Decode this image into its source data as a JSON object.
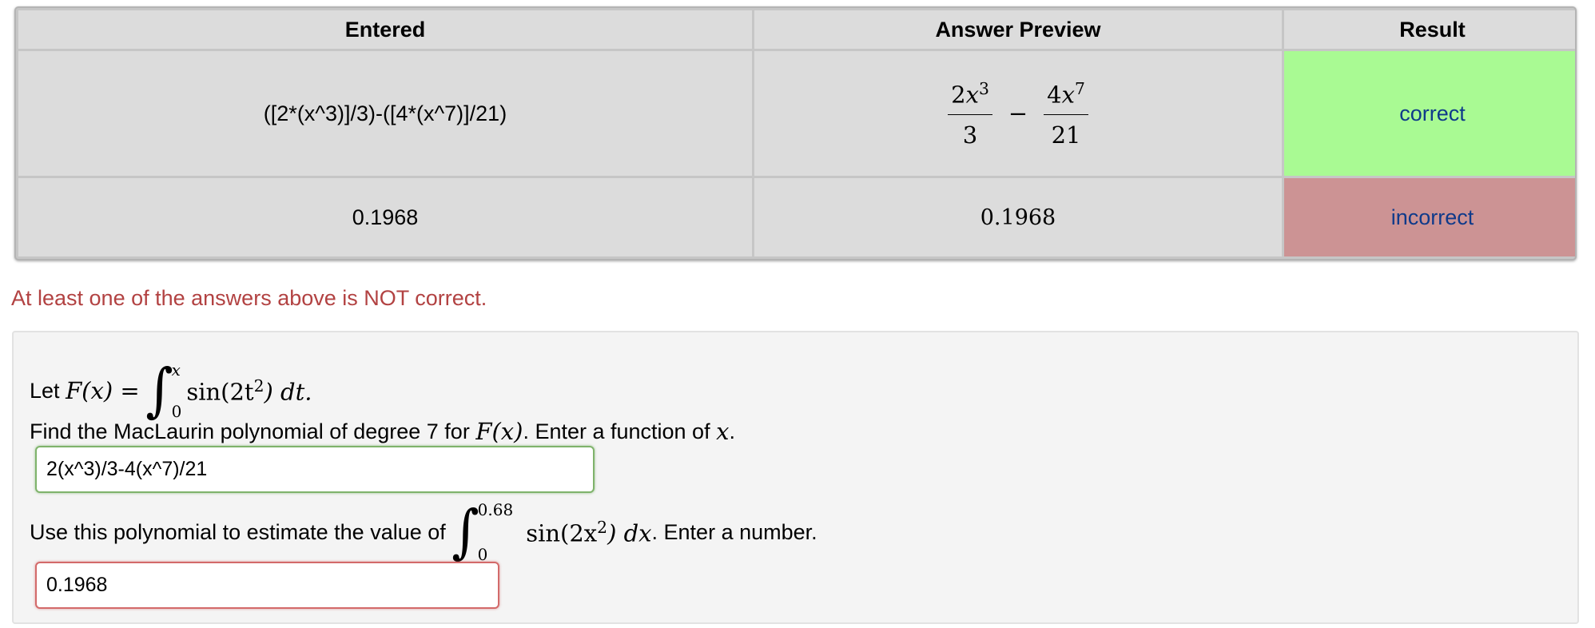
{
  "results_table": {
    "headers": [
      "Entered",
      "Answer Preview",
      "Result"
    ],
    "rows": [
      {
        "entered": "([2*(x^3)]/3)-([4*(x^7)]/21)",
        "preview": {
          "t1_num_coef": "2",
          "t1_var": "x",
          "t1_exp": "3",
          "t1_den": "3",
          "op": "−",
          "t2_num_coef": "4",
          "t2_var": "x",
          "t2_exp": "7",
          "t2_den": "21"
        },
        "result": "correct"
      },
      {
        "entered": "0.1968",
        "preview_text": "0.1968",
        "result": "incorrect"
      }
    ]
  },
  "warning": "At least one of the answers above is NOT correct.",
  "problem": {
    "def_prefix": "Let",
    "def_lhs": "F(x) =",
    "def_upper": "x",
    "def_lower": "0",
    "def_integrand": "sin(2t",
    "def_exp": "2",
    "def_tail": ") dt.",
    "q1_text_before": "Find the MacLaurin polynomial of degree 7 for",
    "q1_fx": "F(x)",
    "q1_text_mid": ". Enter a function of",
    "q1_var": "x",
    "q1_text_end": ".",
    "answer1": "2(x^3)/3-4(x^7)/21",
    "q2_text_before": "Use this polynomial to estimate the value of",
    "q2_upper": "0.68",
    "q2_lower": "0",
    "q2_integrand": "sin(2x",
    "q2_exp": "2",
    "q2_tail": ") dx",
    "q2_text_end": ". Enter a number.",
    "answer2": "0.1968"
  },
  "colors": {
    "correct": "#a9fa93",
    "incorrect": "#cc9394",
    "warning": "#b24242"
  }
}
